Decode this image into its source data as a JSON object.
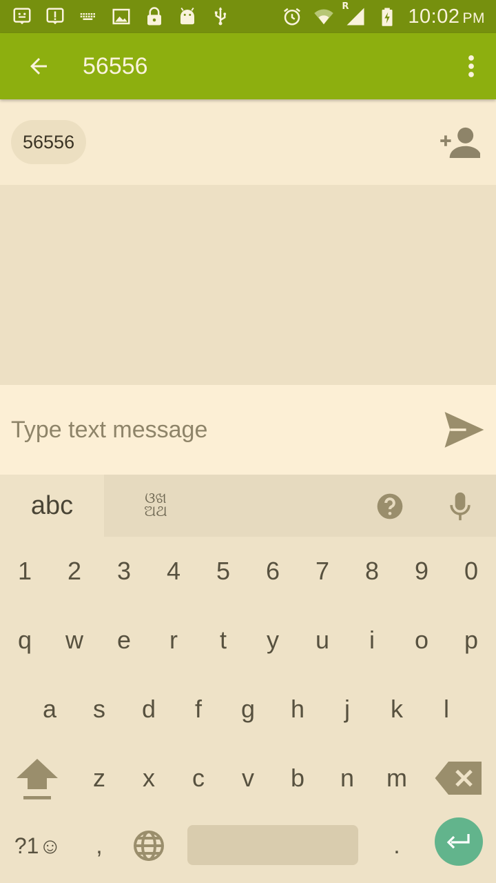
{
  "status_bar": {
    "time": "10:02",
    "ampm": "PM",
    "left_icons": [
      "sim-toolkit-icon",
      "alert-message-icon",
      "keyboard-icon",
      "image-icon",
      "lock-icon",
      "android-icon",
      "usb-icon"
    ],
    "right_icons": [
      "alarm-icon",
      "wifi-icon",
      "signal-roaming-icon",
      "battery-charging-icon"
    ],
    "roaming_label": "R"
  },
  "app_bar": {
    "title": "56556",
    "back_icon": "arrow-back-icon",
    "menu_icon": "more-vert-icon"
  },
  "recipients": {
    "chip_label": "56556",
    "add_contact_icon": "person-add-icon"
  },
  "compose": {
    "placeholder": "Type text message",
    "value": "",
    "send_icon": "send-icon"
  },
  "keyboard": {
    "mode_tab": "abc",
    "script_tab": "ଓଖ ଅଥ",
    "help_icon": "help-icon",
    "mic_icon": "mic-icon",
    "row_numbers": [
      "1",
      "2",
      "3",
      "4",
      "5",
      "6",
      "7",
      "8",
      "9",
      "0"
    ],
    "row_1": [
      "q",
      "w",
      "e",
      "r",
      "t",
      "y",
      "u",
      "i",
      "o",
      "p"
    ],
    "row_2": [
      "a",
      "s",
      "d",
      "f",
      "g",
      "h",
      "j",
      "k",
      "l"
    ],
    "row_3": [
      "z",
      "x",
      "c",
      "v",
      "b",
      "n",
      "m"
    ],
    "symbols_key": "?1☺",
    "comma_key": ",",
    "period_key": ".",
    "shift_icon": "shift-icon",
    "delete_icon": "backspace-icon",
    "globe_icon": "globe-icon",
    "enter_icon": "enter-icon"
  },
  "colors": {
    "status_bar": "#76900E",
    "app_bar": "#8DAF0F",
    "enter_key": "#62B48C"
  }
}
